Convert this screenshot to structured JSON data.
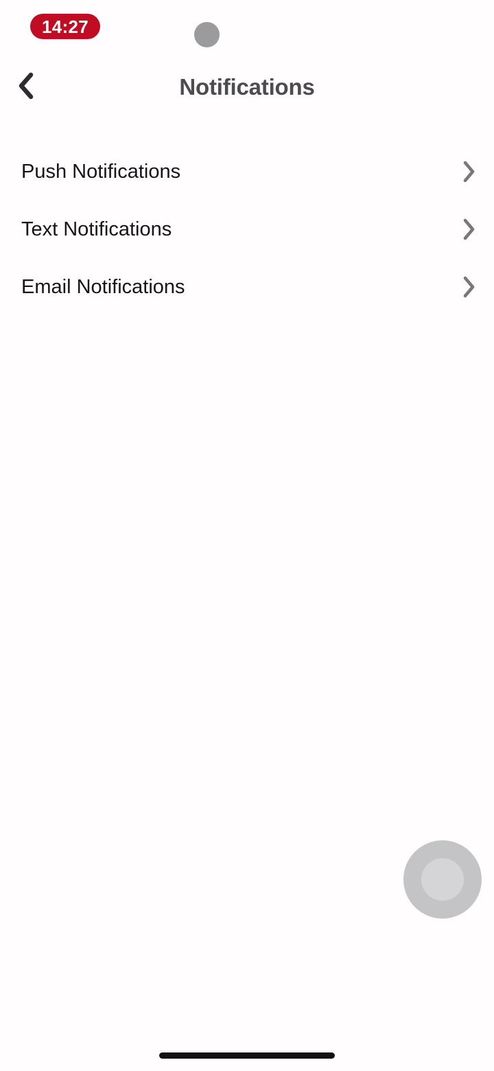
{
  "status_bar": {
    "time": "14:27",
    "time_pill_color": "#c00d24",
    "icons": {
      "signal": "signal-bars-icon",
      "signal_bars_filled": 1,
      "signal_bars_total": 4,
      "wifi": "wifi-icon",
      "battery": "battery-icon",
      "battery_color": "#c00d24"
    }
  },
  "nav": {
    "back_label": "Back",
    "title": "Notifications",
    "title_color": "#4b4b50"
  },
  "list": {
    "rows": [
      {
        "label": "Push Notifications",
        "chevron": "chevron-right-icon"
      },
      {
        "label": "Text Notifications",
        "chevron": "chevron-right-icon"
      },
      {
        "label": "Email Notifications",
        "chevron": "chevron-right-icon"
      }
    ]
  },
  "overlays": {
    "tap_indicator_color": "#9b9b9e",
    "assistive_touch_label": "AssistiveTouch",
    "assistive_touch_color": "#c4c4c6",
    "home_indicator_color": "#111114"
  }
}
